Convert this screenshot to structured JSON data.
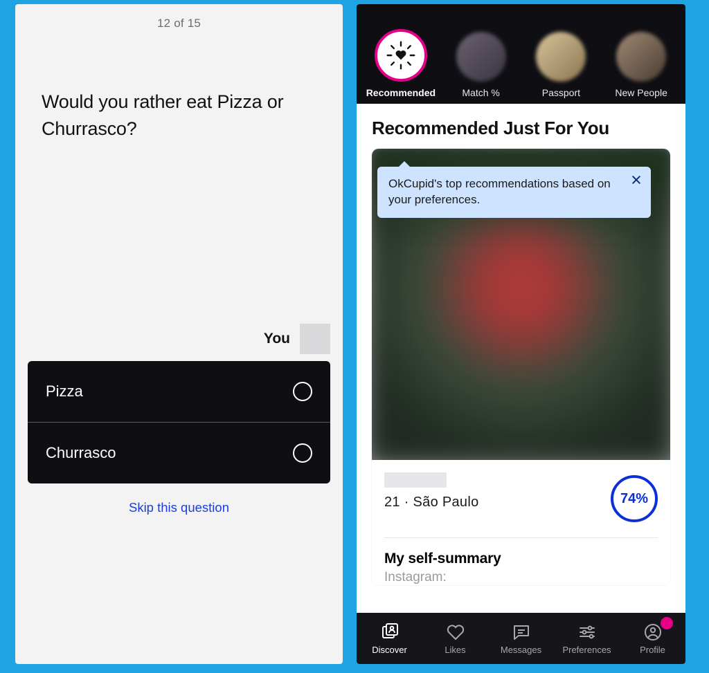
{
  "left": {
    "counter": "12 of 15",
    "question": "Would you rather eat Pizza or Churrasco?",
    "you_label": "You",
    "options": [
      "Pizza",
      "Churrasco"
    ],
    "skip": "Skip this question"
  },
  "right": {
    "top_tabs": [
      {
        "label": "Recommended",
        "active": true,
        "icon": "heart-spark-icon"
      },
      {
        "label": "Match %",
        "active": false,
        "icon": "thumb"
      },
      {
        "label": "Passport",
        "active": false,
        "icon": "thumb"
      },
      {
        "label": "New People",
        "active": false,
        "icon": "thumb"
      }
    ],
    "section_title": "Recommended Just For You",
    "tooltip": "OkCupid's top recommendations based on your preferences.",
    "profile": {
      "age_city": "21 · São Paulo",
      "match_pct": "74%",
      "summary_heading": "My self-summary",
      "instagram_label": "Instagram:"
    },
    "bottom_nav": [
      {
        "label": "Discover",
        "icon": "discover-icon",
        "active": true
      },
      {
        "label": "Likes",
        "icon": "heart-icon",
        "active": false
      },
      {
        "label": "Messages",
        "icon": "chat-icon",
        "active": false
      },
      {
        "label": "Preferences",
        "icon": "sliders-icon",
        "active": false
      },
      {
        "label": "Profile",
        "icon": "profile-icon",
        "active": false,
        "badge": true
      }
    ]
  }
}
